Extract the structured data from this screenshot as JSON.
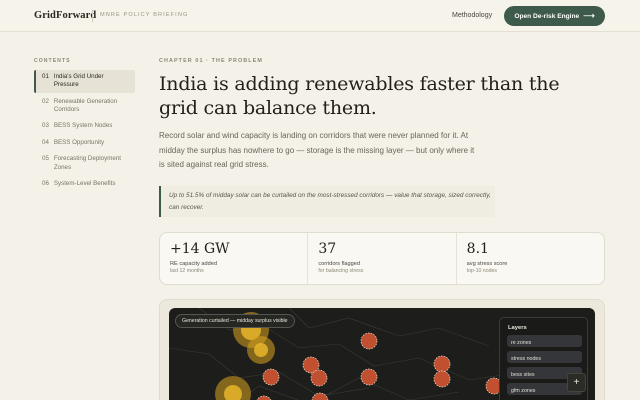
{
  "header": {
    "brand": "GridForward",
    "subtitle": "MNRE POLICY BRIEFING",
    "nav_methodology": "Methodology",
    "cta_label": "Open De-risk Engine",
    "cta_arrow": "⟶"
  },
  "toc": {
    "heading": "CONTENTS",
    "items": [
      {
        "num": "01",
        "label": "India's Grid Under Pressure",
        "active": true
      },
      {
        "num": "02",
        "label": "Renewable Generation Corridors"
      },
      {
        "num": "03",
        "label": "BESS System Nodes"
      },
      {
        "num": "04",
        "label": "BESS Opportunity"
      },
      {
        "num": "05",
        "label": "Forecasting Deployment Zones"
      },
      {
        "num": "06",
        "label": "System-Level Benefits"
      }
    ]
  },
  "main": {
    "chapter": "CHAPTER 01 · THE PROBLEM",
    "headline": "India is adding renewables faster than the grid can balance them.",
    "lede": "Record solar and wind capacity is landing on corridors that were never planned for it. At midday the surplus has nowhere to go — storage is the missing layer — but only where it is sited against real grid stress.",
    "quote": "Up to 51.5% of midday solar can be curtailed on the most-stressed corridors — value that storage, sized correctly, can recover."
  },
  "stats": [
    {
      "value": "+14 GW",
      "label": "RE capacity added",
      "sub": "last 12 months"
    },
    {
      "value": "37",
      "label": "corridors flagged",
      "sub": "for balancing stress"
    },
    {
      "value": "8.1",
      "label": "avg stress score",
      "sub": "top-10 nodes"
    }
  ],
  "map": {
    "badge": "Generation curtailed — midday surplus visible",
    "layers_title": "Layers",
    "layers": [
      "re zones",
      "stress nodes",
      "bess sites",
      "gfm zones"
    ],
    "zoom_in": "+",
    "colors": {
      "curtail": "#d9a21f",
      "stress": "#c0502f",
      "map_bg": "#1d1e1b"
    }
  }
}
